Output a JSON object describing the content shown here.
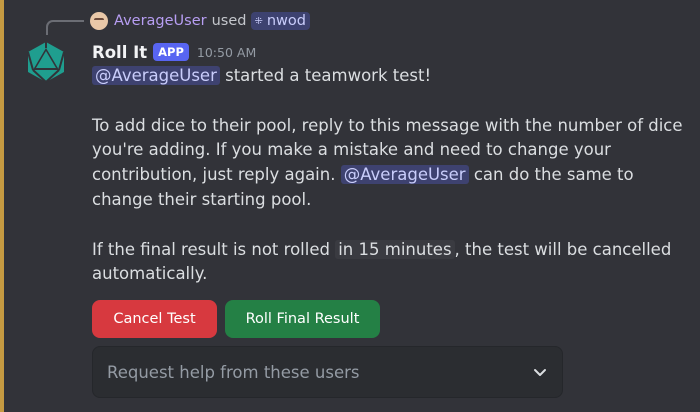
{
  "reply": {
    "username": "AverageUser",
    "used_text": "used",
    "command": "nwod",
    "command_icon": "app-command-icon"
  },
  "message": {
    "author": "Roll It",
    "badge": "APP",
    "time": "10:50 AM",
    "line1_mention": "@AverageUser",
    "line1_text": " started a teamwork test!",
    "para2_text": "To add dice to their pool, reply to this message with the number of dice you're adding. If you make a mistake and need to change your contribution, just reply again. ",
    "para2_mention": "@AverageUser",
    "para2_tail": " can do the same to change their starting pool.",
    "para3_text": "If the final result is not rolled ",
    "para3_code": "in 15 minutes",
    "para3_tail": ", the test will be cancelled automatically."
  },
  "actions": {
    "cancel_label": "Cancel Test",
    "roll_label": "Roll Final Result"
  },
  "select": {
    "placeholder": "Request help from these users"
  },
  "colors": {
    "accent_bar": "#c59a42",
    "danger": "#d7393f",
    "success": "#248045",
    "app_badge": "#5865f2",
    "mention_bg": "#3e4270"
  },
  "icons": {
    "avatar": "d20-dice-icon",
    "select_chevron": "chevron-down-icon"
  }
}
